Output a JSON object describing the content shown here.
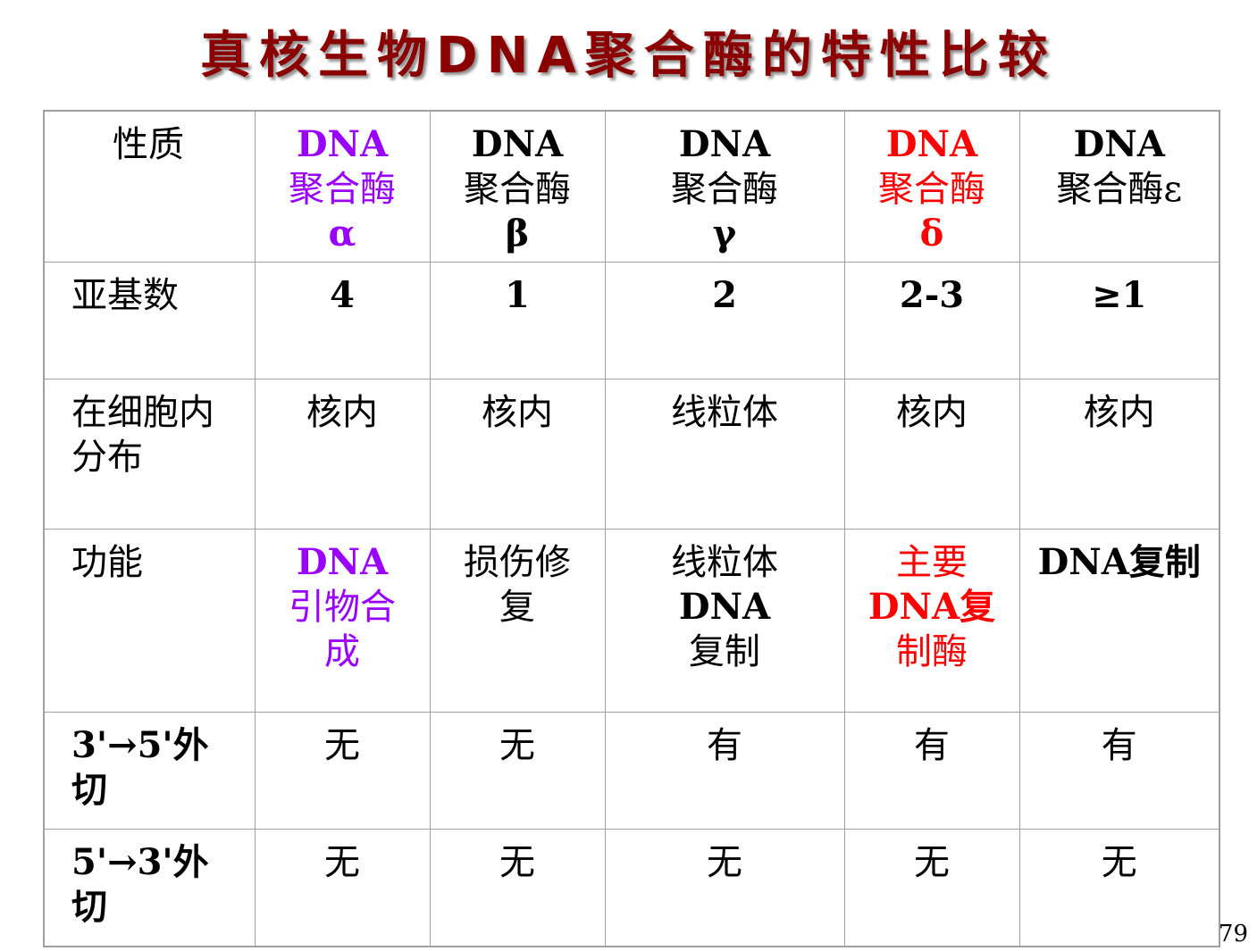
{
  "title": "真核生物DNA聚合酶的特性比较",
  "colors": {
    "title": "#8b0000",
    "alpha_column": "#9900ff",
    "delta_column": "#ff0000",
    "text": "#000000",
    "border": "#a0a0a0"
  },
  "table": {
    "corner_label": "性质",
    "headers": {
      "alpha": {
        "line1": "DNA",
        "line2": "聚合酶",
        "line3": "α"
      },
      "beta": {
        "line1": "DNA",
        "line2": "聚合酶",
        "line3": "β"
      },
      "gamma": {
        "line1": "DNA",
        "line2": "聚合酶",
        "line3": "γ"
      },
      "delta": {
        "line1": "DNA",
        "line2": "聚合酶",
        "line3": "δ"
      },
      "epsilon": {
        "line1": "DNA",
        "line2": "聚合酶ε"
      }
    },
    "rows": {
      "subunits": {
        "label": "亚基数",
        "alpha": "4",
        "beta": "1",
        "gamma": "2",
        "delta": "2-3",
        "epsilon": "≥1"
      },
      "location": {
        "label": "在细胞内\n分布",
        "alpha": "核内",
        "beta": "核内",
        "gamma": "线粒体",
        "delta": "核内",
        "epsilon": "核内"
      },
      "function": {
        "label": "功能",
        "alpha": {
          "line1": "DNA",
          "line2": "引物合\n成"
        },
        "beta": "损伤修\n复",
        "gamma": {
          "line1": "线粒体",
          "line2": "DNA",
          "line3": "复制"
        },
        "delta": {
          "line1": "主要",
          "line2": "DNA复",
          "line3": "制酶"
        },
        "epsilon": "DNA复制"
      },
      "exo_3to5": {
        "label": "3'→5'外\n切",
        "alpha": "无",
        "beta": "无",
        "gamma": "有",
        "delta": "有",
        "epsilon": "有"
      },
      "exo_5to3": {
        "label": "5'→3'外\n切",
        "alpha": "无",
        "beta": "无",
        "gamma": "无",
        "delta": "无",
        "epsilon": "无"
      }
    }
  },
  "page_number": "79"
}
